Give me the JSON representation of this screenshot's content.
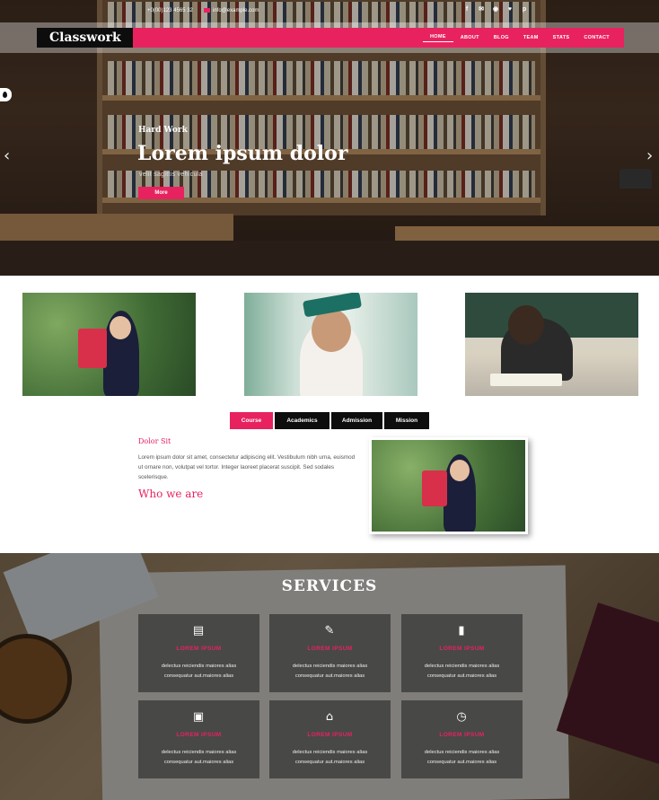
{
  "topbar": {
    "phone": "+0(00)123 4565 32",
    "email": "info@example.com",
    "social_icons": [
      "facebook-icon",
      "envelope-icon",
      "rss-icon",
      "twitter-icon",
      "pinterest-icon"
    ]
  },
  "brand": "Classwork",
  "nav": [
    "HOME",
    "ABOUT",
    "BLOG",
    "TEAM",
    "STATS",
    "CONTACT"
  ],
  "hero": {
    "subtitle": "Hard Work",
    "title": "Lorem ipsum dolor",
    "tagline": "velit sagittis vehicula",
    "button": "More"
  },
  "tabs": [
    "Course",
    "Academics",
    "Admission",
    "Mission"
  ],
  "tab_content": {
    "heading": "Dolor Sit",
    "body": "Lorem ipsum dolor sit amet, consectetur adipiscing elit. Vestibulum nibh urna, euismod ut ornare non, volutpat vel tortor. Integer laoreet placerat suscipit. Sed sodales scelerisque.",
    "who_heading": "Who we are"
  },
  "services": {
    "title": "SERVICES",
    "cards": [
      {
        "icon": "book-icon",
        "glyph": "▤",
        "title": "LOREM IPSUM",
        "desc": "delectus reiciendis maiores alias consequatur aut.maiores alias"
      },
      {
        "icon": "pencil-icon",
        "glyph": "✎",
        "title": "LOREM IPSUM",
        "desc": "delectus reiciendis maiores alias consequatur aut.maiores alias"
      },
      {
        "icon": "bookmark-icon",
        "glyph": "▮",
        "title": "LOREM IPSUM",
        "desc": "delectus reiciendis maiores alias consequatur aut.maiores alias"
      },
      {
        "icon": "address-book-icon",
        "glyph": "▣",
        "title": "LOREM IPSUM",
        "desc": "delectus reiciendis maiores alias consequatur aut.maiores alias"
      },
      {
        "icon": "graduation-cap-icon",
        "glyph": "⌂",
        "title": "LOREM IPSUM",
        "desc": "delectus reiciendis maiores alias consequatur aut.maiores alias"
      },
      {
        "icon": "clock-icon",
        "glyph": "◷",
        "title": "LOREM IPSUM",
        "desc": "delectus reiciendis maiores alias consequatur aut.maiores alias"
      }
    ]
  },
  "colors": {
    "accent": "#e8225f",
    "dark": "#0d0d0d"
  }
}
